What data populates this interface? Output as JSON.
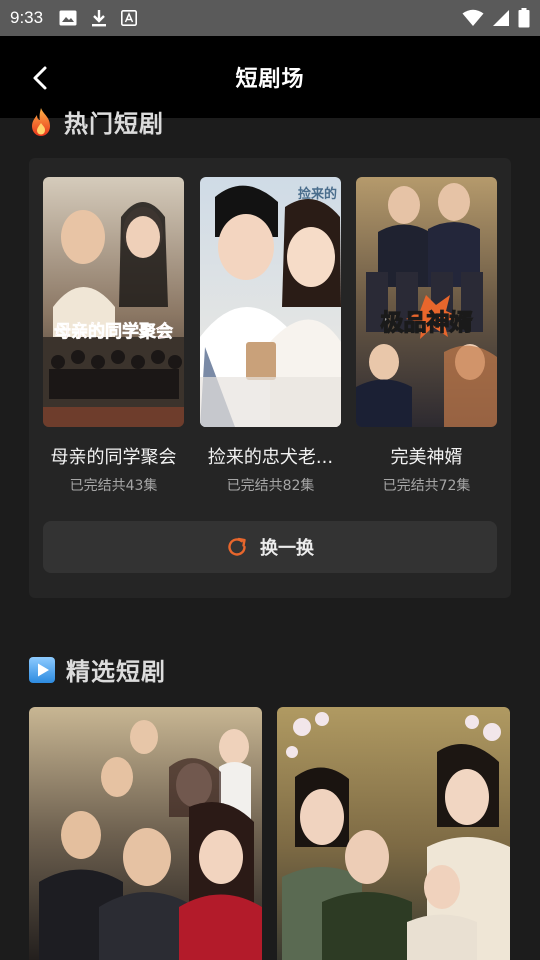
{
  "status_bar": {
    "time": "9:33",
    "left_icons": [
      "image-icon",
      "download-icon",
      "font-icon"
    ],
    "right_icons": [
      "wifi-icon",
      "signal-icon",
      "battery-icon"
    ]
  },
  "header": {
    "title": "短剧场",
    "back_icon": "chevron-left-icon"
  },
  "hot_section": {
    "icon": "fire-icon",
    "title": "热门短剧",
    "dramas": [
      {
        "name": "母亲的同学聚会",
        "subtitle": "已完结共43集",
        "poster_text": "母亲的同学聚会",
        "colors": [
          "#c9b79c",
          "#7d6750",
          "#3b2f27"
        ]
      },
      {
        "name": "捡来的忠犬老...",
        "subtitle": "已完结共82集",
        "poster_text": "捡来的",
        "colors": [
          "#dfe4ea",
          "#b9c7d6",
          "#efe9e1"
        ]
      },
      {
        "name": "完美神婿",
        "subtitle": "已完结共72集",
        "poster_text": "极品神婿",
        "colors": [
          "#8a7a5e",
          "#3a3a44",
          "#c9a46c"
        ]
      }
    ],
    "refresh_icon": "refresh-icon",
    "refresh_label": "换一换"
  },
  "picks_section": {
    "icon": "play-icon",
    "title": "精选短剧",
    "cards": [
      {
        "colors": [
          "#b8a27e",
          "#5a4a3a",
          "#2a2420"
        ]
      },
      {
        "colors": [
          "#a58a52",
          "#6b5a3a",
          "#3a3a2e"
        ]
      }
    ]
  },
  "accent_color": "#e8662c"
}
